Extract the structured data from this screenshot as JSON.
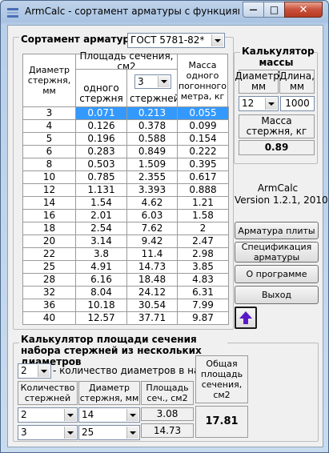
{
  "window": {
    "title": "ArmCalc - сортамент арматуры с функциями ...",
    "min_symbol": "—",
    "max_symbol": "□",
    "close_symbol": "✕"
  },
  "assortment": {
    "group_title": "Сортамент арматуры",
    "standard_value": "ГОСТ 5781-82*",
    "col_diameter": "Диаметр стержня, мм",
    "col_area": "Площадь сечения, см2",
    "col_one": "одного стержня",
    "col_n_value": "3",
    "col_n_label": "стержней",
    "col_mass": "Масса одного погонного метра, кг",
    "rows": [
      [
        "3",
        "0.071",
        "0.213",
        "0.055"
      ],
      [
        "4",
        "0.126",
        "0.378",
        "0.099"
      ],
      [
        "5",
        "0.196",
        "0.588",
        "0.154"
      ],
      [
        "6",
        "0.283",
        "0.849",
        "0.222"
      ],
      [
        "8",
        "0.503",
        "1.509",
        "0.395"
      ],
      [
        "10",
        "0.785",
        "2.355",
        "0.617"
      ],
      [
        "12",
        "1.131",
        "3.393",
        "0.888"
      ],
      [
        "14",
        "1.54",
        "4.62",
        "1.21"
      ],
      [
        "16",
        "2.01",
        "6.03",
        "1.58"
      ],
      [
        "18",
        "2.54",
        "7.62",
        "2"
      ],
      [
        "20",
        "3.14",
        "9.42",
        "2.47"
      ],
      [
        "22",
        "3.8",
        "11.4",
        "2.98"
      ],
      [
        "25",
        "4.91",
        "14.73",
        "3.85"
      ],
      [
        "28",
        "6.16",
        "18.48",
        "4.83"
      ],
      [
        "32",
        "8.04",
        "24.12",
        "6.31"
      ],
      [
        "36",
        "10.18",
        "30.54",
        "7.99"
      ],
      [
        "40",
        "12.57",
        "37.71",
        "9.87"
      ]
    ],
    "selected_row": 0
  },
  "mass_calc": {
    "title": "Калькулятор массы стержня",
    "diameter_label": "Диаметр, мм",
    "length_label": "Длина, мм",
    "diameter_value": "12",
    "length_value": "1000",
    "mass_label": "Масса стержня, кг",
    "mass_value": "0.89"
  },
  "about": {
    "app": "ArmCalc",
    "version": "Version 1.2.1,   2010"
  },
  "buttons": {
    "plate": "Арматура плиты",
    "spec": "Спецификация арматуры",
    "program": "О программе",
    "exit": "Выход",
    "up_icon": "up-arrow-icon"
  },
  "area_calc": {
    "title": "Калькулятор площади сечения набора стержней из нескольких диаметров",
    "count_value": "2",
    "count_label": "- количество диаметров в наборе",
    "col_qty": "Количество стержней",
    "col_diam": "Диаметр стержня, мм",
    "col_area": "Площадь сеч., см2",
    "col_total": "Общая площадь сечения, см2",
    "rows": [
      {
        "qty": "2",
        "diam": "14",
        "area": "3.08"
      },
      {
        "qty": "3",
        "diam": "25",
        "area": "14.73"
      }
    ],
    "total": "17.81"
  },
  "colors": {
    "selection": "#3399ff",
    "arrow": "#5a18c8"
  }
}
